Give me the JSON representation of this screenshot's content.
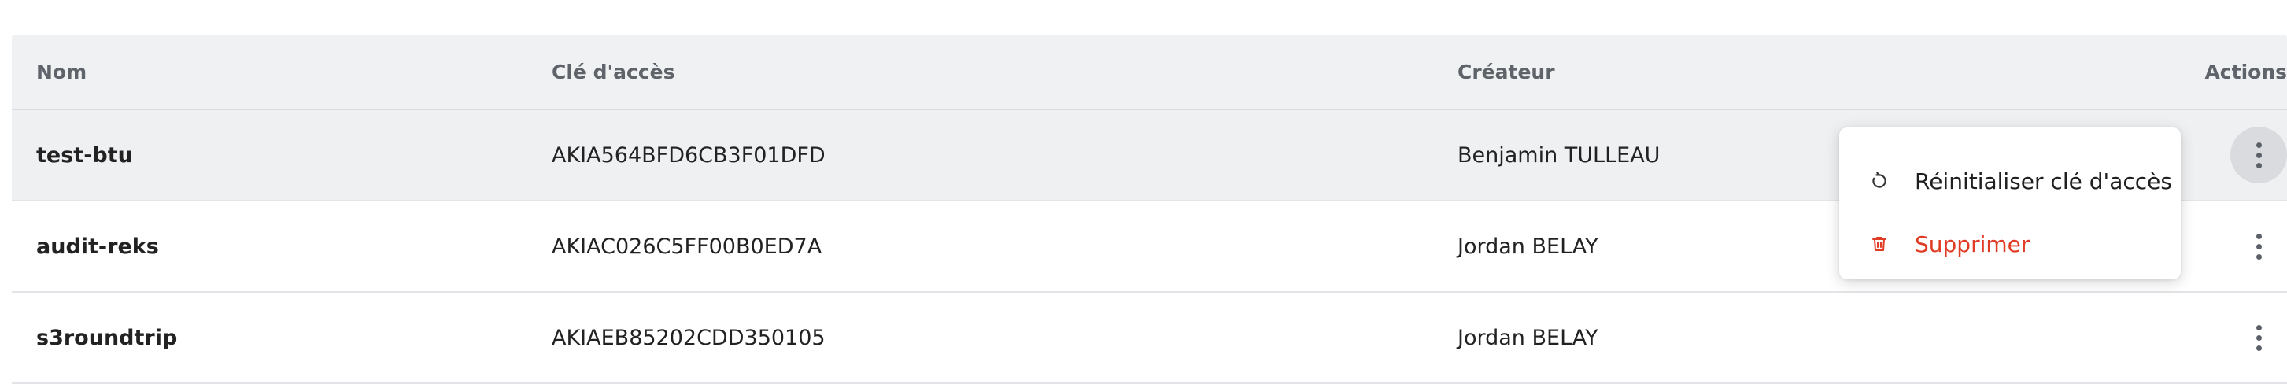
{
  "table": {
    "headers": {
      "name": "Nom",
      "key": "Clé d'accès",
      "creator": "Créateur",
      "actions": "Actions"
    },
    "rows": [
      {
        "name": "test-btu",
        "key": "AKIA564BFD6CB3F01DFD",
        "creator": "Benjamin TULLEAU"
      },
      {
        "name": "audit-reks",
        "key": "AKIAC026C5FF00B0ED7A",
        "creator": "Jordan BELAY"
      },
      {
        "name": "s3roundtrip",
        "key": "AKIAEB85202CDD350105",
        "creator": "Jordan BELAY"
      }
    ]
  },
  "menu": {
    "reset_label": "Réinitialiser clé d'accès",
    "reset_icon": "refresh-icon",
    "delete_label": "Supprimer",
    "delete_icon": "trash-icon",
    "delete_color": "#e03b24"
  }
}
